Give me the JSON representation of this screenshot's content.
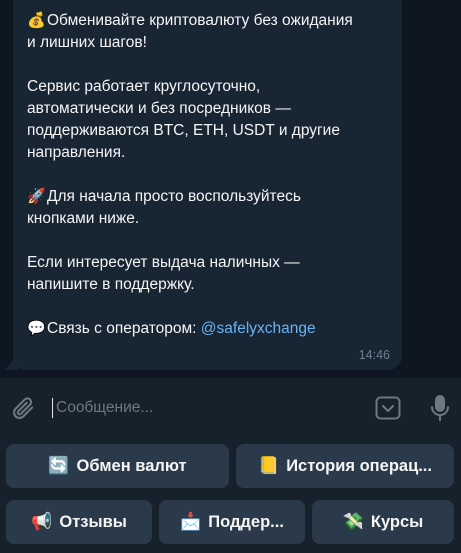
{
  "message": {
    "lines": [
      {
        "emoji": "💰",
        "text": "Обменивайте криптовалюту без ожидания"
      },
      {
        "text": "и лишних шагов!"
      },
      {
        "gap": true
      },
      {
        "text": "Сервис работает круглосуточно,"
      },
      {
        "text": "автоматически и без посредников —"
      },
      {
        "text": "поддерживаются BTC, ETH, USDT и другие"
      },
      {
        "text": "направления."
      },
      {
        "gap": true
      },
      {
        "emoji": "🚀",
        "text": "Для начала просто воспользуйтесь"
      },
      {
        "text": "кнопками ниже."
      },
      {
        "gap": true
      },
      {
        "text": "Если интересует выдача наличных —"
      },
      {
        "text": "напишите в поддержку."
      },
      {
        "gap": true
      }
    ],
    "contact": {
      "emoji": "💬",
      "text": "Связь с оператором: ",
      "link": "@safelyxchange"
    },
    "time": "14:46"
  },
  "input": {
    "placeholder": "Сообщение..."
  },
  "icons": {
    "attach": "paperclip-icon",
    "keyboard": "keyboard-icon",
    "mic": "microphone-icon"
  },
  "keyboard_buttons": [
    {
      "icon": "🔄",
      "label": "Обмен валют"
    },
    {
      "icon": "📒",
      "label": "История операц..."
    },
    {
      "icon": "📢",
      "label": "Отзывы"
    },
    {
      "icon": "📩",
      "label": "Поддер..."
    },
    {
      "icon": "💸",
      "label": "Курсы"
    }
  ],
  "colors": {
    "background": "#0e1621",
    "bubble": "#182533",
    "panel": "#17212b",
    "button": "#2b3a4a",
    "link": "#6ab3f3"
  }
}
